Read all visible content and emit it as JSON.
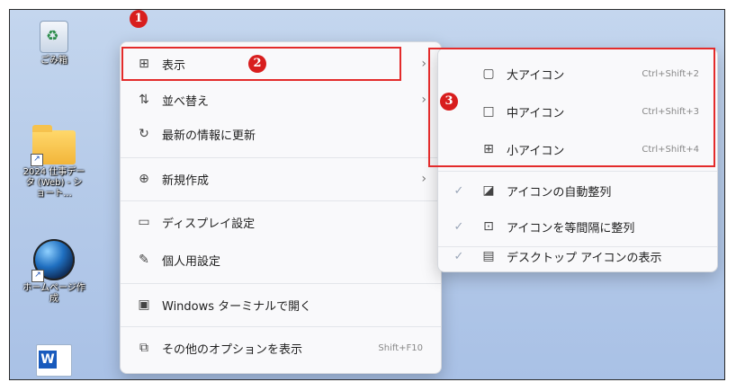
{
  "desktop": {
    "icons": [
      {
        "name": "recycle-bin",
        "label": "ごみ箱"
      },
      {
        "name": "folder",
        "label": "2024 仕事データ (Web) - ショート..."
      },
      {
        "name": "globe",
        "label": "ホームページ作成"
      },
      {
        "name": "word",
        "label": ""
      }
    ]
  },
  "context_menu": {
    "items": [
      {
        "label": "表示",
        "icon": "grid-icon",
        "submenu": true
      },
      {
        "label": "並べ替え",
        "icon": "sort-icon",
        "submenu": true
      },
      {
        "label": "最新の情報に更新",
        "icon": "refresh-icon"
      },
      {
        "label": "新規作成",
        "icon": "plus-circle-icon",
        "submenu": true
      },
      {
        "label": "ディスプレイ設定",
        "icon": "display-icon"
      },
      {
        "label": "個人用設定",
        "icon": "brush-icon"
      },
      {
        "label": "Windows ターミナルで開く",
        "icon": "terminal-icon"
      },
      {
        "label": "その他のオプションを表示",
        "icon": "more-options-icon",
        "shortcut": "Shift+F10"
      }
    ]
  },
  "view_submenu": {
    "items": [
      {
        "label": "大アイコン",
        "icon": "large-icon",
        "shortcut": "Ctrl+Shift+2"
      },
      {
        "label": "中アイコン",
        "icon": "medium-icon",
        "shortcut": "Ctrl+Shift+3"
      },
      {
        "label": "小アイコン",
        "icon": "small-icon",
        "shortcut": "Ctrl+Shift+4"
      },
      {
        "label": "アイコンの自動整列",
        "icon": "auto-arrange-icon",
        "checked": true
      },
      {
        "label": "アイコンを等間隔に整列",
        "icon": "align-grid-icon",
        "checked": true
      },
      {
        "label": "デスクトップ アイコンの表示",
        "icon": "show-desktop-icons-icon",
        "checked": true
      }
    ]
  },
  "annotations": {
    "badge1": "1",
    "badge2": "2",
    "badge3": "3",
    "highlight_color": "#e32b2b"
  }
}
